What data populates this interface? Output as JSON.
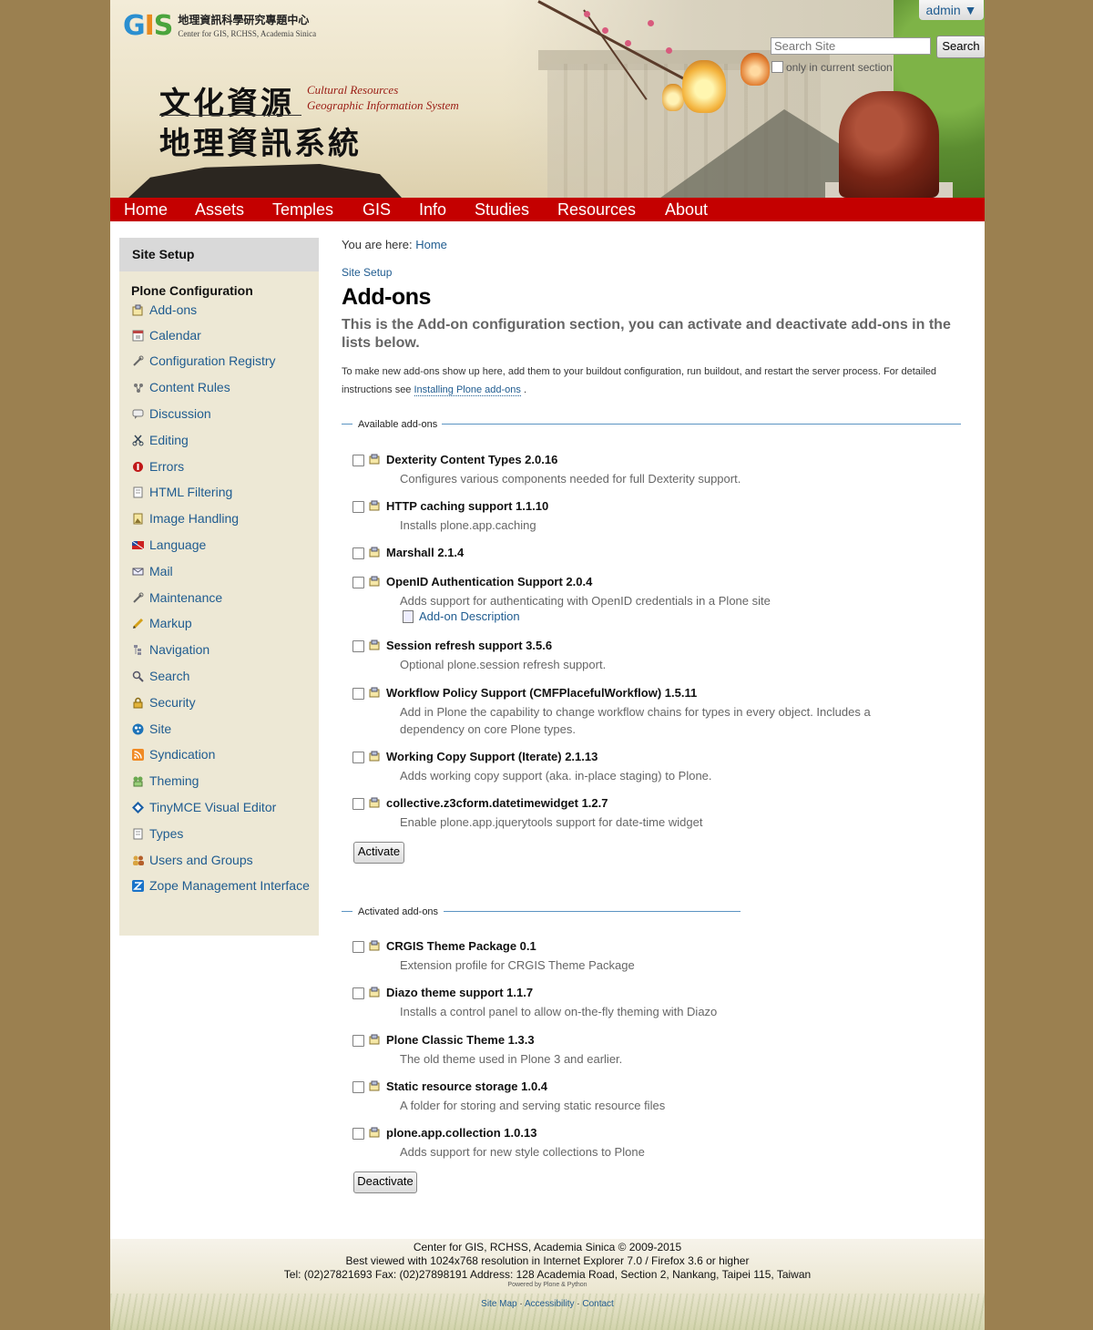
{
  "header": {
    "logo_mark": "GIS",
    "logo_zh": "地理資訊科學研究專題中心",
    "logo_en": "Center for GIS, RCHSS, Academia Sinica",
    "title_zh_line1": "文化資源",
    "title_zh_line2": "地理資訊系統",
    "title_en_line1": "Cultural Resources",
    "title_en_line2": "Geographic Information System",
    "admin_label": "admin ▼",
    "search_placeholder": "Search Site",
    "search_button": "Search",
    "search_scope_label": "only in current section"
  },
  "nav": {
    "items": [
      "Home",
      "Assets",
      "Temples",
      "GIS",
      "Info",
      "Studies",
      "Resources",
      "About"
    ]
  },
  "sidebar": {
    "title": "Site Setup",
    "section": "Plone Configuration",
    "items": [
      {
        "label": "Add-ons",
        "icon": "addons-icon"
      },
      {
        "label": "Calendar",
        "icon": "calendar-icon"
      },
      {
        "label": "Configuration Registry",
        "icon": "wrench-icon"
      },
      {
        "label": "Content Rules",
        "icon": "content-rules-icon"
      },
      {
        "label": "Discussion",
        "icon": "discussion-icon"
      },
      {
        "label": "Editing",
        "icon": "scissors-icon"
      },
      {
        "label": "Errors",
        "icon": "errors-icon"
      },
      {
        "label": "HTML Filtering",
        "icon": "document-icon"
      },
      {
        "label": "Image Handling",
        "icon": "image-icon"
      },
      {
        "label": "Language",
        "icon": "flag-icon"
      },
      {
        "label": "Mail",
        "icon": "mail-icon"
      },
      {
        "label": "Maintenance",
        "icon": "wrench-icon"
      },
      {
        "label": "Markup",
        "icon": "pencil-icon"
      },
      {
        "label": "Navigation",
        "icon": "navigation-icon"
      },
      {
        "label": "Search",
        "icon": "magnifier-icon"
      },
      {
        "label": "Security",
        "icon": "lock-icon"
      },
      {
        "label": "Site",
        "icon": "plone-logo-icon"
      },
      {
        "label": "Syndication",
        "icon": "rss-icon"
      },
      {
        "label": "Theming",
        "icon": "theming-icon"
      },
      {
        "label": "TinyMCE Visual Editor",
        "icon": "tinymce-icon"
      },
      {
        "label": "Types",
        "icon": "document-icon"
      },
      {
        "label": "Users and Groups",
        "icon": "users-icon"
      },
      {
        "label": "Zope Management Interface",
        "icon": "zope-icon"
      }
    ]
  },
  "content": {
    "breadcrumb_prefix": "You are here:",
    "breadcrumb_home": "Home",
    "setup_link": "Site Setup",
    "title": "Add-ons",
    "lead": "This is the Add-on configuration section, you can activate and deactivate add-ons in the lists below.",
    "help_text": "To make new add-ons show up here, add them to your buildout configuration, run buildout, and restart the server process. For detailed instructions see",
    "help_link": "Installing Plone add-ons",
    "help_tail": ".",
    "available_legend": "Available add-ons",
    "activated_legend": "Activated add-ons",
    "activate_button": "Activate",
    "deactivate_button": "Deactivate",
    "addon_description_link": "Add-on Description",
    "available": [
      {
        "name": "Dexterity Content Types 2.0.16",
        "desc": "Configures various components needed for full Dexterity support."
      },
      {
        "name": "HTTP caching support 1.1.10",
        "desc": "Installs plone.app.caching"
      },
      {
        "name": "Marshall 2.1.4",
        "desc": ""
      },
      {
        "name": "OpenID Authentication Support 2.0.4",
        "desc": "Adds support for authenticating with OpenID credentials in a Plone site"
      },
      {
        "name": "Session refresh support 3.5.6",
        "desc": "Optional plone.session refresh support."
      },
      {
        "name": "Workflow Policy Support (CMFPlacefulWorkflow) 1.5.11",
        "desc": "Add in Plone the capability to change workflow chains for types in every object. Includes a dependency on core Plone types."
      },
      {
        "name": "Working Copy Support (Iterate) 2.1.13",
        "desc": "Adds working copy support (aka. in-place staging) to Plone."
      },
      {
        "name": "collective.z3cform.datetimewidget 1.2.7",
        "desc": "Enable plone.app.jquerytools support for date-time widget"
      }
    ],
    "activated": [
      {
        "name": "CRGIS Theme Package 0.1",
        "desc": "Extension profile for CRGIS Theme Package"
      },
      {
        "name": "Diazo theme support 1.1.7",
        "desc": "Installs a control panel to allow on-the-fly theming with Diazo"
      },
      {
        "name": "Plone Classic Theme 1.3.3",
        "desc": "The old theme used in Plone 3 and earlier."
      },
      {
        "name": "Static resource storage 1.0.4",
        "desc": "A folder for storing and serving static resource files"
      },
      {
        "name": "plone.app.collection 1.0.13",
        "desc": "Adds support for new style collections to Plone"
      }
    ]
  },
  "footer": {
    "line1": "Center for GIS, RCHSS, Academia Sinica © 2009-2015",
    "line2": "Best viewed with 1024x768 resolution in Internet Explorer 7.0 / Firefox 3.6 or higher",
    "line3": "Tel: (02)27821693 Fax: (02)27898191 Address: 128 Academia Road, Section 2, Nankang, Taipei 115, Taiwan",
    "powered": "Powered by Plone & Python",
    "link_sitemap": "Site Map",
    "link_accessibility": "Accessibility",
    "link_contact": "Contact",
    "separator": "·"
  }
}
